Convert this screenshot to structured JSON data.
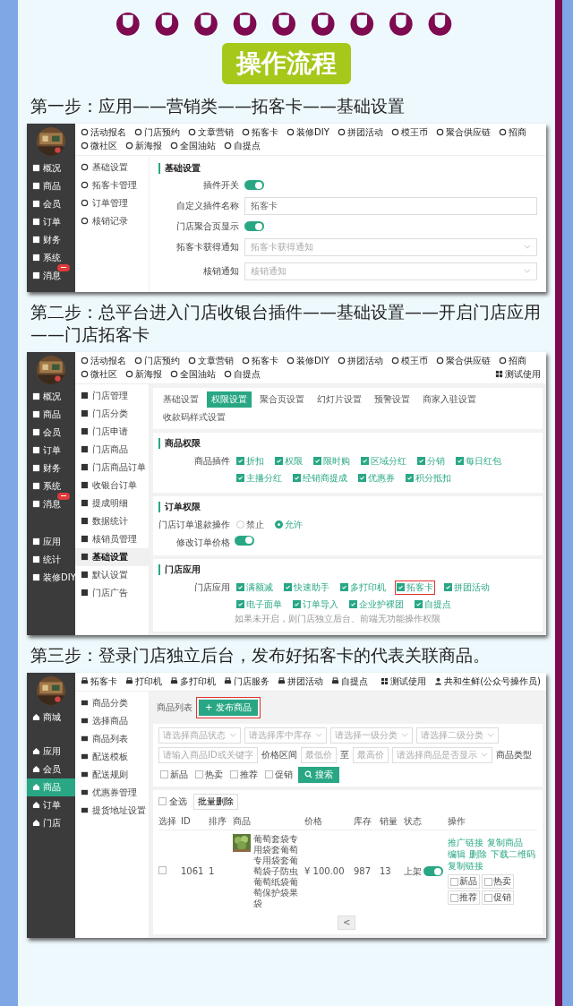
{
  "title": "操作流程",
  "step_1": {
    "heading": "第一步：应用——营销类——拓客卡——基础设置",
    "sidebar": [
      {
        "label": "概况",
        "badge": false
      },
      {
        "label": "商品",
        "badge": false
      },
      {
        "label": "会员",
        "badge": false
      },
      {
        "label": "订单",
        "badge": false
      },
      {
        "label": "财务",
        "badge": false
      },
      {
        "label": "系统",
        "badge": false
      },
      {
        "label": "消息",
        "badge": true
      }
    ],
    "nav": [
      "活动报名",
      "门店预约",
      "文章营销",
      "拓客卡",
      "装修DIY",
      "拼团活动",
      "模王币",
      "聚合供应链",
      "招商",
      "微社区",
      "新海报",
      "全国油站",
      "自提点"
    ],
    "subnav": [
      "基础设置",
      "拓客卡管理",
      "订单管理",
      "核销记录"
    ],
    "section_title": "基础设置",
    "form": [
      {
        "kind": "switch",
        "label": "插件开关",
        "on": true
      },
      {
        "kind": "input",
        "label": "自定义插件名称",
        "value": "拓客卡"
      },
      {
        "kind": "switch",
        "label": "门店聚合页显示",
        "on": true
      },
      {
        "kind": "select",
        "label": "拓客卡获得通知",
        "placeholder": "拓客卡获得通知"
      },
      {
        "kind": "select",
        "label": "核销通知",
        "placeholder": "核销通知"
      }
    ]
  },
  "step_2": {
    "heading": "第二步：总平台进入门店收银台插件——基础设置——开启门店应用——门店拓客卡",
    "sidebar": [
      {
        "label": "概况",
        "badge": false
      },
      {
        "label": "商品",
        "badge": false
      },
      {
        "label": "会员",
        "badge": false
      },
      {
        "label": "订单",
        "badge": false
      },
      {
        "label": "财务",
        "badge": false
      },
      {
        "label": "系统",
        "badge": false
      },
      {
        "label": "消息",
        "badge": true
      }
    ],
    "sidebar_lower": [
      "应用",
      "统计",
      "装修DIY"
    ],
    "nav": [
      "活动报名",
      "门店预约",
      "文章营销",
      "拓客卡",
      "装修DIY",
      "拼团活动",
      "模王币",
      "聚合供应链",
      "招商",
      "微社区",
      "新海报",
      "全国油站",
      "自提点"
    ],
    "top_right": "测试使用",
    "subnav": [
      {
        "label": "门店管理",
        "selected": false
      },
      {
        "label": "门店分类",
        "selected": false
      },
      {
        "label": "门店申请",
        "selected": false
      },
      {
        "label": "门店商品",
        "selected": false
      },
      {
        "label": "门店商品订单",
        "selected": false
      },
      {
        "label": "收银台订单",
        "selected": false
      },
      {
        "label": "提成明细",
        "selected": false
      },
      {
        "label": "数据统计",
        "selected": false
      },
      {
        "label": "核销员管理",
        "selected": false
      },
      {
        "label": "基础设置",
        "selected": true
      },
      {
        "label": "默认设置",
        "selected": false
      },
      {
        "label": "门店广告",
        "selected": false
      }
    ],
    "tabs": [
      {
        "label": "基础设置",
        "selected": false
      },
      {
        "label": "权限设置",
        "selected": true
      },
      {
        "label": "聚合页设置",
        "selected": false
      },
      {
        "label": "幻灯片设置",
        "selected": false
      },
      {
        "label": "预警设置",
        "selected": false
      },
      {
        "label": "商家入驻设置",
        "selected": false
      },
      {
        "label": "收款码样式设置",
        "selected": false
      }
    ],
    "sections": [
      {
        "title": "商品权限",
        "rows": [
          {
            "kind": "checks",
            "label": "商品插件",
            "options": [
              {
                "label": "折扣",
                "checked": true,
                "highlighted": false
              },
              {
                "label": "权限",
                "checked": true,
                "highlighted": false
              },
              {
                "label": "限时购",
                "checked": true,
                "highlighted": false
              },
              {
                "label": "区域分红",
                "checked": true,
                "highlighted": false
              },
              {
                "label": "分销",
                "checked": true,
                "highlighted": false
              },
              {
                "label": "每日红包",
                "checked": true,
                "highlighted": false
              },
              {
                "label": "主播分红",
                "checked": true,
                "highlighted": false
              },
              {
                "label": "经销商提成",
                "checked": true,
                "highlighted": false
              },
              {
                "label": "优惠券",
                "checked": true,
                "highlighted": false
              },
              {
                "label": "积分抵扣",
                "checked": true,
                "highlighted": false
              }
            ]
          }
        ]
      },
      {
        "title": "订单权限",
        "rows": [
          {
            "kind": "radio",
            "label": "门店订单退款操作",
            "options": [
              {
                "label": "禁止",
                "selected": false
              },
              {
                "label": "允许",
                "selected": true
              }
            ]
          },
          {
            "kind": "switch",
            "label": "修改订单价格",
            "on": true
          }
        ]
      },
      {
        "title": "门店应用",
        "rows": [
          {
            "kind": "checks",
            "label": "门店应用",
            "note": "如果未开启，则门店独立后台、前端无功能操作权限",
            "options": [
              {
                "label": "满额减",
                "checked": true,
                "highlighted": false
              },
              {
                "label": "快速助手",
                "checked": true,
                "highlighted": false
              },
              {
                "label": "多打印机",
                "checked": true,
                "highlighted": false
              },
              {
                "label": "拓客卡",
                "checked": true,
                "highlighted": true
              },
              {
                "label": "拼团活动",
                "checked": true,
                "highlighted": false
              },
              {
                "label": "电子面单",
                "checked": true,
                "highlighted": false
              },
              {
                "label": "订单导入",
                "checked": true,
                "highlighted": false
              },
              {
                "label": "企业护裸团",
                "checked": true,
                "highlighted": false
              },
              {
                "label": "自提点",
                "checked": true,
                "highlighted": false
              }
            ]
          }
        ]
      }
    ]
  },
  "step_3": {
    "heading": "第三步：登录门店独立后台，发布好拓客卡的代表关联商品。",
    "sidebar": [
      {
        "label": "商城",
        "selected": false
      },
      {
        "label": "应用",
        "selected": false
      },
      {
        "label": "会员",
        "selected": false
      },
      {
        "label": "商品",
        "selected": true
      },
      {
        "label": "订单",
        "selected": false
      },
      {
        "label": "门店",
        "selected": false
      }
    ],
    "nav": [
      "拓客卡",
      "打印机",
      "多打印机",
      "门店服务",
      "拼团活动",
      "自提点"
    ],
    "top_right": [
      "测试使用",
      "共和生鲜(公众号操作员)"
    ],
    "subnav": [
      "商品分类",
      "选择商品",
      "商品列表",
      "配送模板",
      "配送规则",
      "优惠券管理",
      "提货地址设置"
    ],
    "page_title": "商品列表",
    "publish_button": {
      "label": "+ 发布商品",
      "highlighted": true
    },
    "filters": [
      {
        "kind": "select",
        "placeholder": "请选择商品状态"
      },
      {
        "kind": "select",
        "placeholder": "请选择库中库存"
      },
      {
        "kind": "select",
        "placeholder": "请选择一级分类"
      },
      {
        "kind": "select",
        "placeholder": "请选择二级分类"
      },
      {
        "kind": "input",
        "placeholder": "请输入商品ID或关键字"
      },
      {
        "kind": "label",
        "text": "价格区间"
      },
      {
        "kind": "input",
        "placeholder": "最低价"
      },
      {
        "kind": "label",
        "text": "至"
      },
      {
        "kind": "input",
        "placeholder": "最高价"
      },
      {
        "kind": "select",
        "placeholder": "请选择商品是否显示"
      },
      {
        "kind": "label",
        "text": "商品类型"
      },
      {
        "kind": "checkbox",
        "label": "新品",
        "checked": false
      },
      {
        "kind": "checkbox",
        "label": "热卖",
        "checked": false
      },
      {
        "kind": "checkbox",
        "label": "推荐",
        "checked": false
      },
      {
        "kind": "checkbox",
        "label": "促销",
        "checked": false
      },
      {
        "kind": "button",
        "label": "搜索"
      }
    ],
    "select_all": {
      "label": "全选",
      "checked": false
    },
    "bulk_delete": "批量删除",
    "columns": [
      "选择",
      "ID",
      "排序",
      "商品",
      "价格",
      "库存",
      "销量",
      "状态",
      "操作"
    ],
    "rows": [
      {
        "checked": false,
        "id": "1061",
        "sort": "1",
        "product": "葡萄套袋专用袋套葡萄专用袋套葡萄袋子防虫葡萄纸袋葡萄保护袋果袋",
        "price": "¥ 100.00",
        "stock": "987",
        "sales": "13",
        "status": "上架",
        "on": true,
        "links": [
          "推广链接",
          "复制商品",
          "编辑",
          "删除",
          "下载二维码",
          "复制链接"
        ],
        "tags": [
          {
            "label": "新品",
            "checked": false
          },
          {
            "label": "热卖",
            "checked": false
          },
          {
            "label": "推荐",
            "checked": false
          },
          {
            "label": "促销",
            "checked": false
          }
        ]
      }
    ],
    "pagination_prev": "<"
  }
}
